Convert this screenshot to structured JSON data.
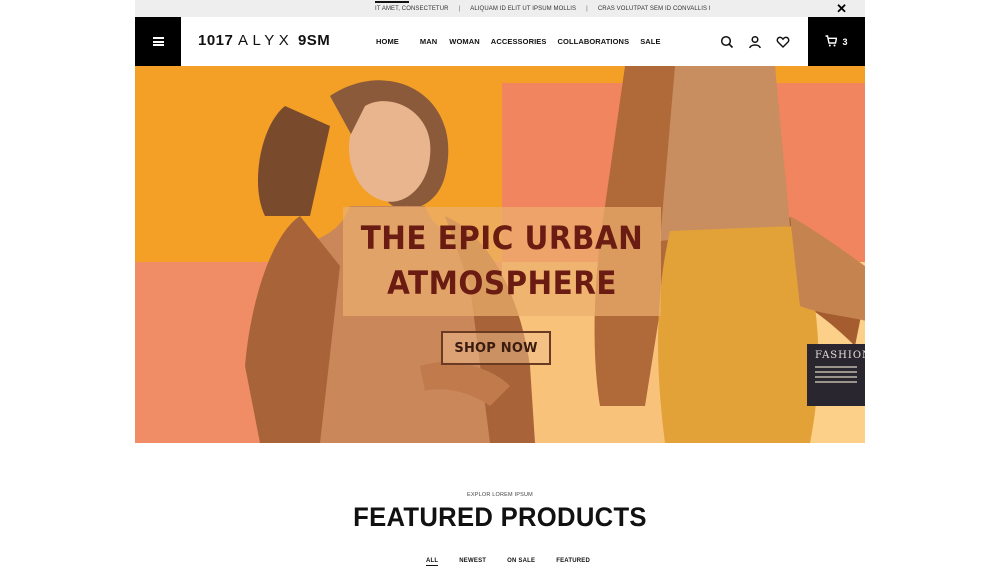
{
  "announcement": {
    "items": [
      "IT AMET, CONSECTETUR",
      "ALIQUAM ID ELIT UT IPSUM MOLLIS",
      "CRAS VOLUTPAT SEM ID CONVALLIS I"
    ],
    "separator": "|",
    "close_icon": "close-icon"
  },
  "header": {
    "menu_icon": "hamburger-menu-icon",
    "logo_prefix": "1017 ",
    "logo_spaced": "ALYX",
    "logo_suffix": " 9SM",
    "nav": [
      "HOME",
      "MAN",
      "WOMAN",
      "ACCESSORIES",
      "COLLABORATIONS",
      "SALE"
    ],
    "icons": [
      "search-icon",
      "user-icon",
      "heart-icon"
    ],
    "cart_icon": "cart-icon",
    "cart_count": "3"
  },
  "hero": {
    "title_line1": "THE EPIC URBAN",
    "title_line2": "ATMOSPHERE",
    "cta": "SHOP NOW",
    "card_title": "FASHION",
    "colors": {
      "orange": "#f4a027",
      "salmon": "#f08560",
      "yellow": "#f9c27a",
      "title": "#6a1b12"
    }
  },
  "featured": {
    "kicker": "EXPLOR LOREM IPSUM",
    "title": "FEATURED PRODUCTS",
    "filters": [
      "ALL",
      "NEWEST",
      "ON SALE",
      "FEATURED"
    ]
  }
}
